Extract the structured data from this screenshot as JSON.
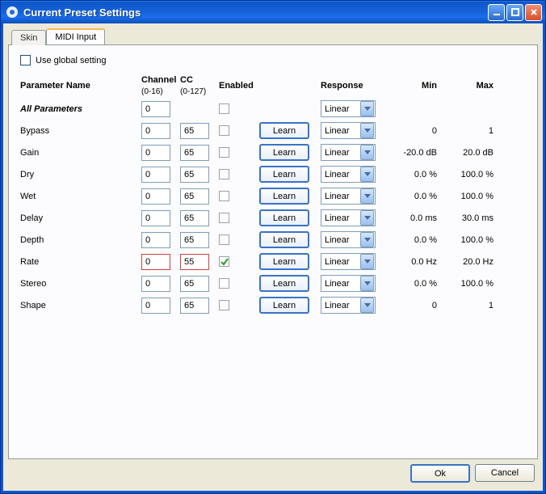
{
  "window": {
    "title": "Current Preset Settings",
    "minimize_tip": "Minimize",
    "maximize_tip": "Maximize",
    "close_tip": "Close"
  },
  "tabs": {
    "skin": "Skin",
    "midi": "MIDI Input"
  },
  "global": {
    "label": "Use global setting",
    "checked": false
  },
  "headers": {
    "param": "Parameter Name",
    "channel": "Channel",
    "channel_sub": "(0-16)",
    "cc": "CC",
    "cc_sub": "(0-127)",
    "enabled": "Enabled",
    "response": "Response",
    "min": "Min",
    "max": "Max"
  },
  "learn_label": "Learn",
  "response_value": "Linear",
  "rows": [
    {
      "name": "All Parameters",
      "all": true,
      "channel": "0",
      "cc": "",
      "enabled": false,
      "learn": false,
      "response": true,
      "min": "",
      "max": "",
      "highlight": false
    },
    {
      "name": "Bypass",
      "all": false,
      "channel": "0",
      "cc": "65",
      "enabled": false,
      "learn": true,
      "response": true,
      "min": "0",
      "max": "1",
      "highlight": false
    },
    {
      "name": "Gain",
      "all": false,
      "channel": "0",
      "cc": "65",
      "enabled": false,
      "learn": true,
      "response": true,
      "min": "-20.0 dB",
      "max": "20.0 dB",
      "highlight": false
    },
    {
      "name": "Dry",
      "all": false,
      "channel": "0",
      "cc": "65",
      "enabled": false,
      "learn": true,
      "response": true,
      "min": "0.0 %",
      "max": "100.0 %",
      "highlight": false
    },
    {
      "name": "Wet",
      "all": false,
      "channel": "0",
      "cc": "65",
      "enabled": false,
      "learn": true,
      "response": true,
      "min": "0.0 %",
      "max": "100.0 %",
      "highlight": false
    },
    {
      "name": "Delay",
      "all": false,
      "channel": "0",
      "cc": "65",
      "enabled": false,
      "learn": true,
      "response": true,
      "min": "0.0 ms",
      "max": "30.0 ms",
      "highlight": false
    },
    {
      "name": "Depth",
      "all": false,
      "channel": "0",
      "cc": "65",
      "enabled": false,
      "learn": true,
      "response": true,
      "min": "0.0 %",
      "max": "100.0 %",
      "highlight": false
    },
    {
      "name": "Rate",
      "all": false,
      "channel": "0",
      "cc": "55",
      "enabled": true,
      "learn": true,
      "response": true,
      "min": "0.0 Hz",
      "max": "20.0 Hz",
      "highlight": true
    },
    {
      "name": "Stereo",
      "all": false,
      "channel": "0",
      "cc": "65",
      "enabled": false,
      "learn": true,
      "response": true,
      "min": "0.0 %",
      "max": "100.0 %",
      "highlight": false
    },
    {
      "name": "Shape",
      "all": false,
      "channel": "0",
      "cc": "65",
      "enabled": false,
      "learn": true,
      "response": true,
      "min": "0",
      "max": "1",
      "highlight": false
    }
  ],
  "buttons": {
    "ok": "Ok",
    "cancel": "Cancel"
  }
}
